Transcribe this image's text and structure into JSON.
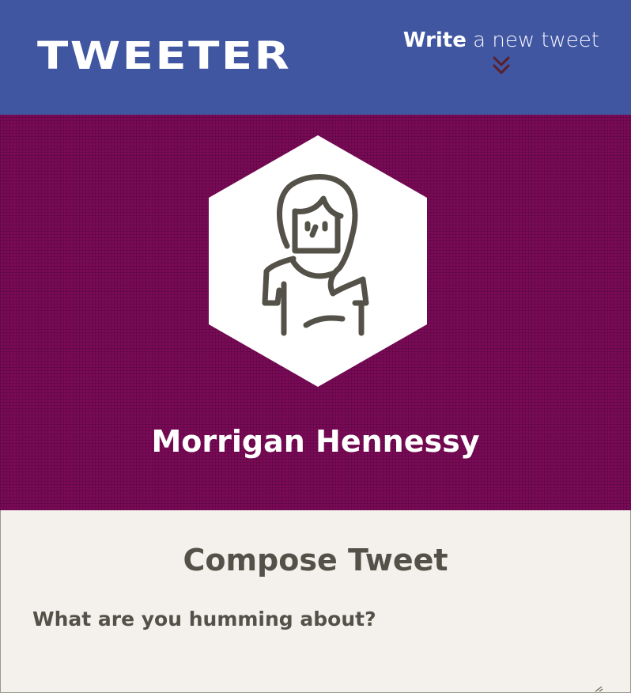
{
  "header": {
    "brand": "TWEETER",
    "compose_toggle": {
      "strong": "Write",
      "rest": "a new tweet",
      "icon": "double-chevron-down-icon"
    }
  },
  "profile": {
    "avatar_icon": "user-avatar-icon",
    "name": "Morrigan Hennessy"
  },
  "compose": {
    "title": "Compose Tweet",
    "placeholder": "What are you humming about?",
    "value": ""
  },
  "colors": {
    "nav_bg": "#4056a1",
    "profile_bg": "#7a0a57",
    "page_bg": "#f4f1ec",
    "text": "#545149",
    "chevron": "#5a1f2a"
  }
}
